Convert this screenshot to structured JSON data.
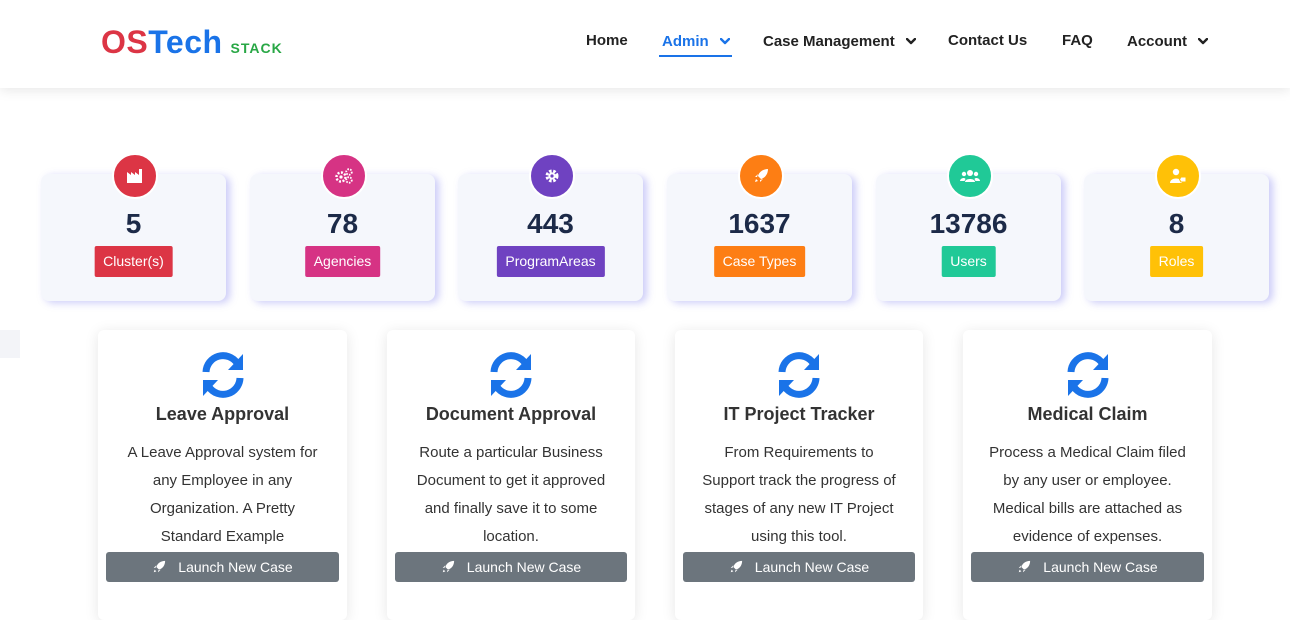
{
  "brand": {
    "part1": "OS",
    "part2": "Tech",
    "part3": "STACK"
  },
  "nav": {
    "items": [
      {
        "label": "Home"
      },
      {
        "label": "Admin"
      },
      {
        "label": "Case Management"
      },
      {
        "label": "Contact Us"
      },
      {
        "label": "FAQ"
      },
      {
        "label": "Account"
      }
    ]
  },
  "stats": [
    {
      "value": "5",
      "label": "Cluster(s)",
      "color": "#dc3545",
      "icon": "industry-icon"
    },
    {
      "value": "78",
      "label": "Agencies",
      "color": "#d63384",
      "icon": "cogs-icon"
    },
    {
      "value": "443",
      "label": "ProgramAreas",
      "color": "#6f42c1",
      "icon": "cog-icon"
    },
    {
      "value": "1637",
      "label": "Case Types",
      "color": "#fd7e14",
      "icon": "rocket-icon"
    },
    {
      "value": "13786",
      "label": "Users",
      "color": "#20c997",
      "icon": "users-icon"
    },
    {
      "value": "8",
      "label": "Roles",
      "color": "#ffc107",
      "icon": "user-tag-icon"
    }
  ],
  "processes": [
    {
      "title": "Leave Approval",
      "description": "A Leave Approval system for any Employee in any Organization. A Pretty Standard Example",
      "button": "Launch New Case"
    },
    {
      "title": "Document Approval",
      "description": "Route a particular Business Document to get it approved and finally save it to some location.",
      "button": "Launch New Case"
    },
    {
      "title": "IT Project Tracker",
      "description": "From Requirements to Support track the progress of stages of any new IT Project using this tool.",
      "button": "Launch New Case"
    },
    {
      "title": "Medical Claim",
      "description": "Process a Medical Claim filed by any user or employee. Medical bills are attached as evidence of expenses.",
      "button": "Launch New Case"
    }
  ],
  "colors": {
    "accent": "#1a73e8",
    "button": "#6c757d",
    "stat_number": "#1c2a48"
  }
}
